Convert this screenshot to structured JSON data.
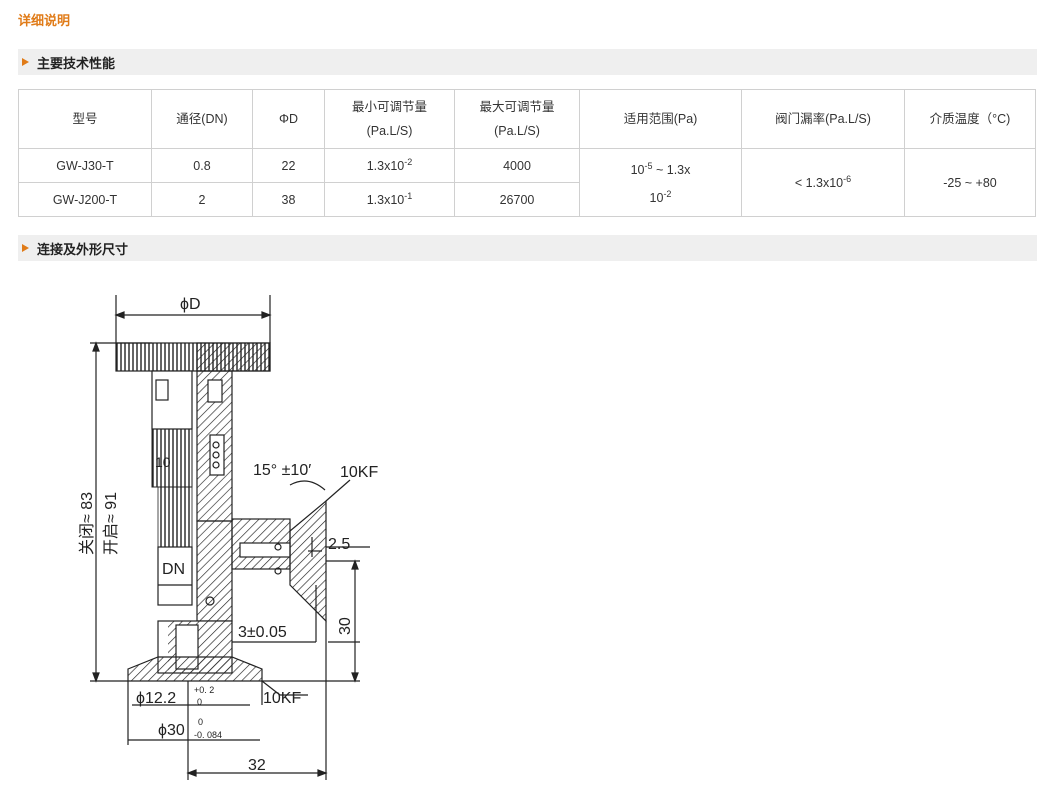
{
  "page": {
    "detail_title": "详细说明",
    "section1_title": "主要技术性能",
    "section2_title": "连接及外形尺寸"
  },
  "table": {
    "headers": {
      "model": "型号",
      "dn": "通径(DN)",
      "phid": "ΦD",
      "min_line1": "最小可调节量",
      "min_line2": "(Pa.L/S)",
      "max_line1": "最大可调节量",
      "max_line2": "(Pa.L/S)",
      "range": "适用范围(Pa)",
      "leak": "阀门漏率(Pa.L/S)",
      "temp": "介质温度（°C)"
    },
    "rows": [
      {
        "model": "GW-J30-T",
        "dn": "0.8",
        "phid": "22",
        "min_base": "1.3x10",
        "min_exp": "-2",
        "max": "4000"
      },
      {
        "model": "GW-J200-T",
        "dn": "2",
        "phid": "38",
        "min_base": "1.3x10",
        "min_exp": "-1",
        "max": "26700"
      }
    ],
    "range": {
      "l1_base": "10",
      "l1_exp": "-5",
      "l1_rest": " ~ 1.3x",
      "l2_base": "10",
      "l2_exp": "-2"
    },
    "leak": {
      "prefix": "< 1.3x10",
      "exp": "-6"
    },
    "temp": "-25 ~ +80"
  },
  "drawing": {
    "phid": "ϕD",
    "angle": "15° ±10′",
    "kf_top": "10KF",
    "dim_2_5": "2.5",
    "dn": "DN",
    "dim_30": "30",
    "dim_3": "3±0.05",
    "closed": "关闭≈ 83",
    "open": "开启≈ 91",
    "dial": "10",
    "phi12": "ϕ12.2",
    "phi12_tol_up": "+0. 2",
    "phi12_tol_dn": "0",
    "kf_bottom": "10KF",
    "phi30": "ϕ30",
    "phi30_tol_up": "0",
    "phi30_tol_dn": "-0. 084",
    "dim_32": "32"
  }
}
